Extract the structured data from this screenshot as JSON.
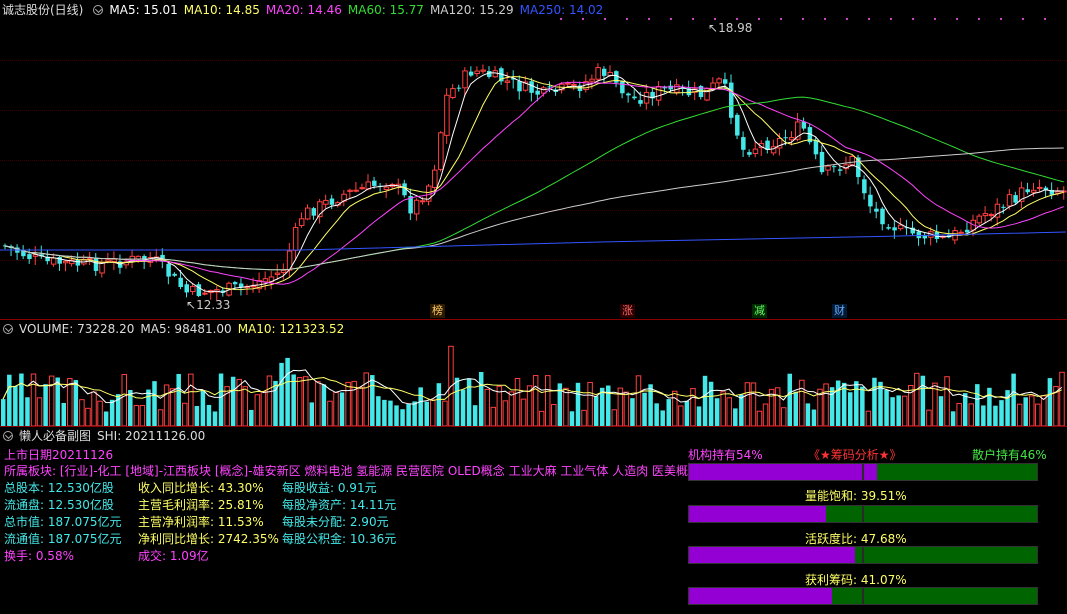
{
  "main_header": {
    "stock_name": "诚志股份(日线)",
    "ma_items": [
      {
        "label": "MA5: 15.01",
        "color": "#ffffff"
      },
      {
        "label": "MA10: 14.85",
        "color": "#ffff66"
      },
      {
        "label": "MA20: 14.46",
        "color": "#ff44ff"
      },
      {
        "label": "MA60: 15.77",
        "color": "#33dd33"
      },
      {
        "label": "MA120: 15.29",
        "color": "#cccccc"
      },
      {
        "label": "MA250: 14.02",
        "color": "#3355ff"
      }
    ]
  },
  "price_labels": {
    "high": "18.98",
    "low": "12.33"
  },
  "events": [
    {
      "label": "榜",
      "color": "#ffcc66",
      "bg": "#2b1a00"
    },
    {
      "label": "涨",
      "color": "#ff6666",
      "bg": "#2a0000"
    },
    {
      "label": "减",
      "color": "#66ff66",
      "bg": "#002a00"
    },
    {
      "label": "财",
      "color": "#66aaff",
      "bg": "#001a33"
    }
  ],
  "volume_header": {
    "title": "VOLUME: 73228.20",
    "ma5": "MA5: 98481.00",
    "ma10": "MA10: 121323.52"
  },
  "sub_header": {
    "title": "懒人必备副图",
    "shi": "SHI: 20211126.00"
  },
  "info": {
    "listing_date": "上市日期20211126",
    "sectors": "所属板块: [行业]-化工 [地域]-江西板块 [概念]-雄安新区 燃料电池 氢能源 民营医院 OLED概念 工业大麻 工业气体 人造肉 医美概念",
    "col1": [
      "总股本: 12.530亿股",
      "流通盘: 12.530亿股",
      "总市值: 187.075亿元",
      "流通值: 187.075亿元",
      "换手: 0.58%"
    ],
    "col2": [
      "收入同比增长: 43.30%",
      "主营毛利润率: 25.81%",
      "主营净利润率: 11.53%",
      "净利同比增长: 2742.35%",
      "成交: 1.09亿"
    ],
    "col3": [
      "每股收益: 0.91元",
      "每股净资产: 14.11元",
      "每股未分配: 2.90元",
      "每股公积金: 10.36元"
    ]
  },
  "chip_panel": {
    "inst_label": "机构持有54%",
    "title": "《★筹码分析★》",
    "retail_label": "散户持有46%",
    "inst_pct": 54,
    "bars": [
      {
        "label": "",
        "value": 54
      },
      {
        "label": "量能饱和: 39.51%",
        "value": 39.51
      },
      {
        "label": "活跃度比: 47.68%",
        "value": 47.68
      },
      {
        "label": "获利筹码: 41.07%",
        "value": 41.07
      }
    ]
  },
  "colors": {
    "up": "#ff4040",
    "down": "#44e8e8",
    "accent": "#8b0000"
  }
}
